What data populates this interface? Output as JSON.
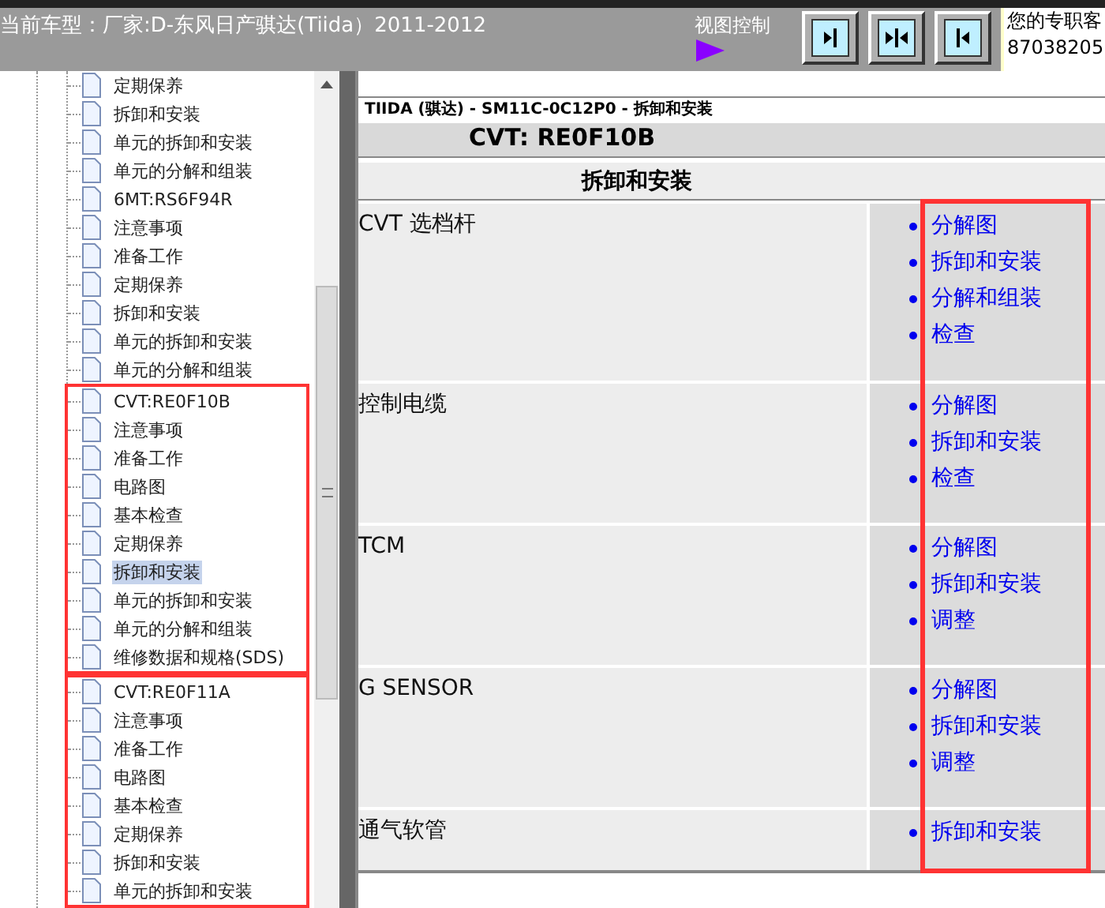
{
  "header": {
    "model": "当前车型：厂家:D-东风日产骐达(Tiida）2011-2012",
    "view_control": "视图控制",
    "contact_line_1": "您的专职客",
    "contact_line_2": "87038205"
  },
  "tree": {
    "groups": [
      {
        "highlighted": false,
        "items": [
          {
            "label": "定期保养",
            "selected": false
          },
          {
            "label": "拆卸和安装",
            "selected": false
          },
          {
            "label": "单元的拆卸和安装",
            "selected": false
          },
          {
            "label": "单元的分解和组装",
            "selected": false
          },
          {
            "label": "6MT:RS6F94R",
            "selected": false
          },
          {
            "label": "注意事项",
            "selected": false
          },
          {
            "label": "准备工作",
            "selected": false
          },
          {
            "label": "定期保养",
            "selected": false
          },
          {
            "label": "拆卸和安装",
            "selected": false
          },
          {
            "label": "单元的拆卸和安装",
            "selected": false
          },
          {
            "label": "单元的分解和组装",
            "selected": false
          }
        ]
      },
      {
        "highlighted": true,
        "items": [
          {
            "label": "CVT:RE0F10B",
            "selected": false
          },
          {
            "label": "注意事项",
            "selected": false
          },
          {
            "label": "准备工作",
            "selected": false
          },
          {
            "label": "电路图",
            "selected": false
          },
          {
            "label": "基本检查",
            "selected": false
          },
          {
            "label": "定期保养",
            "selected": false
          },
          {
            "label": "拆卸和安装",
            "selected": true
          },
          {
            "label": "单元的拆卸和安装",
            "selected": false
          },
          {
            "label": "单元的分解和组装",
            "selected": false
          },
          {
            "label": "维修数据和规格(SDS)",
            "selected": false
          }
        ]
      },
      {
        "highlighted": true,
        "items": [
          {
            "label": "CVT:RE0F11A",
            "selected": false
          },
          {
            "label": "注意事项",
            "selected": false
          },
          {
            "label": "准备工作",
            "selected": false
          },
          {
            "label": "电路图",
            "selected": false
          },
          {
            "label": "基本检查",
            "selected": false
          },
          {
            "label": "定期保养",
            "selected": false
          },
          {
            "label": "拆卸和安装",
            "selected": false
          },
          {
            "label": "单元的拆卸和安装",
            "selected": false
          }
        ]
      }
    ]
  },
  "document": {
    "breadcrumb": "TIIDA (骐达) - SM11C-0C12P0 - 拆卸和安装",
    "heading": "CVT: RE0F10B",
    "section": "拆卸和安装",
    "rows": [
      {
        "name": "CVT 选档杆",
        "links": [
          "分解图",
          "拆卸和安装",
          "分解和组装",
          "检查"
        ]
      },
      {
        "name": "控制电缆",
        "links": [
          "分解图",
          "拆卸和安装",
          "检查"
        ]
      },
      {
        "name": "TCM",
        "links": [
          "分解图",
          "拆卸和安装",
          "调整"
        ]
      },
      {
        "name": "G SENSOR",
        "links": [
          "分解图",
          "拆卸和安装",
          "调整"
        ]
      },
      {
        "name": "通气软管",
        "links": [
          "拆卸和安装"
        ]
      }
    ]
  }
}
